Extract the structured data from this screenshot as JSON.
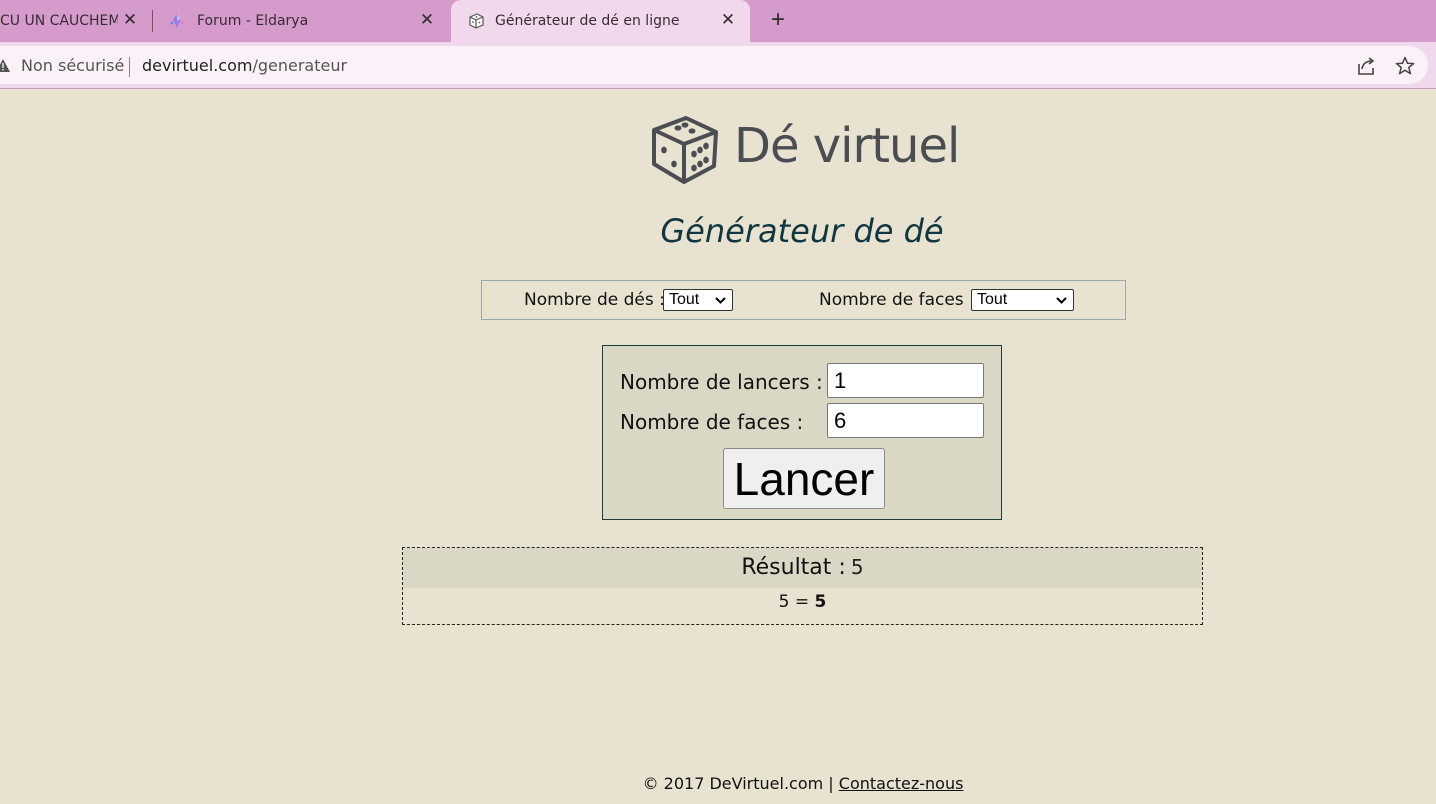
{
  "browser": {
    "tabs": [
      {
        "title": "CU UN CAUCHEMAR",
        "close": "✕"
      },
      {
        "title": "Forum - Eldarya",
        "close": "✕"
      },
      {
        "title": "Générateur de dé en ligne",
        "close": "✕"
      }
    ],
    "new_tab": "+",
    "address": {
      "security_label": "Non sécurisé",
      "domain": "devirtuel.com",
      "path": "/generateur"
    },
    "icons": {
      "share": "share-icon",
      "bookmark": "star-icon",
      "warning": "warning-icon"
    }
  },
  "page": {
    "logo_text": "Dé virtuel",
    "title": "Générateur de dé",
    "filters": {
      "dice_label": "Nombre de dés :",
      "dice_value": "Tout",
      "faces_label": "Nombre de faces :",
      "faces_value": "Tout"
    },
    "form": {
      "throws_label": "Nombre de lancers :",
      "throws_value": "1",
      "faces_label": "Nombre de faces :",
      "faces_value": "6",
      "button_label": "Lancer"
    },
    "result": {
      "label": "Résultat :",
      "value": "5",
      "detail_expr": "5 =",
      "detail_total": "5"
    },
    "footer": {
      "copyright": "© 2017 DeVirtuel.com |",
      "contact_link": "Contactez-nous"
    }
  },
  "colors": {
    "page_bg": "#e8e2d0",
    "tabbar_bg": "#d59ccb",
    "active_tab_bg": "#f0d9ec",
    "panel_bg": "#dbd7c5",
    "title_color": "#10363f"
  }
}
